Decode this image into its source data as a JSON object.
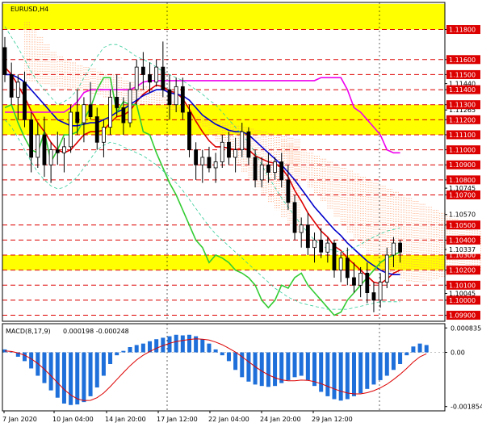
{
  "chart_data": {
    "type": "candlestick",
    "title": "EURUSD,H4",
    "price_scale": {
      "ylim": [
        1.0986,
        1.1198
      ],
      "tick_labels": [
        "1.11800",
        "1.11600",
        "1.11500",
        "1.11440",
        "1.11400",
        "1.11265",
        "1.11300",
        "1.11200",
        "1.11100",
        "1.11000",
        "1.10900",
        "1.10800",
        "1.10745",
        "1.10700",
        "1.10570",
        "1.10500",
        "1.10400",
        "1.10300",
        "1.10337",
        "1.10200",
        "1.10100",
        "1.10045",
        "1.10000",
        "1.09900"
      ],
      "current_price": "1.10337"
    },
    "x_tick_labels": [
      "7 Jan 2020",
      "10 Jan 04:00",
      "14 Jan 20:00",
      "17 Jan 12:00",
      "22 Jan 04:00",
      "24 Jan 20:00",
      "29 Jan 12:00"
    ],
    "levels": [
      1.118,
      1.116,
      1.115,
      1.114,
      1.113,
      1.112,
      1.111,
      1.11,
      1.109,
      1.108,
      1.107,
      1.105,
      1.104,
      1.103,
      1.102,
      1.101,
      1.1,
      1.099
    ],
    "zones": [
      {
        "from": 1.118,
        "to": 1.1197
      },
      {
        "from": 1.111,
        "to": 1.113
      },
      {
        "from": 1.102,
        "to": 1.103
      }
    ],
    "ohlc": [
      [
        1.1168,
        1.1175,
        1.1145,
        1.115
      ],
      [
        1.115,
        1.1158,
        1.113,
        1.1135
      ],
      [
        1.1135,
        1.115,
        1.112,
        1.1145
      ],
      [
        1.1145,
        1.1152,
        1.1115,
        1.112
      ],
      [
        1.112,
        1.1125,
        1.1085,
        1.1095
      ],
      [
        1.1095,
        1.1118,
        1.1088,
        1.111
      ],
      [
        1.111,
        1.1122,
        1.1082,
        1.109
      ],
      [
        1.109,
        1.1105,
        1.1078,
        1.11
      ],
      [
        1.11,
        1.1112,
        1.109,
        1.1098
      ],
      [
        1.1098,
        1.1108,
        1.1085,
        1.1102
      ],
      [
        1.1102,
        1.113,
        1.1098,
        1.1125
      ],
      [
        1.1125,
        1.114,
        1.111,
        1.1118
      ],
      [
        1.1118,
        1.1135,
        1.1105,
        1.113
      ],
      [
        1.113,
        1.1145,
        1.112,
        1.1122
      ],
      [
        1.1122,
        1.1128,
        1.11,
        1.1105
      ],
      [
        1.1105,
        1.112,
        1.1095,
        1.1115
      ],
      [
        1.1115,
        1.114,
        1.111,
        1.1135
      ],
      [
        1.1135,
        1.115,
        1.1122,
        1.1128
      ],
      [
        1.1128,
        1.1135,
        1.111,
        1.1118
      ],
      [
        1.1118,
        1.1145,
        1.1115,
        1.114
      ],
      [
        1.114,
        1.116,
        1.113,
        1.1155
      ],
      [
        1.1155,
        1.1165,
        1.114,
        1.115
      ],
      [
        1.115,
        1.1158,
        1.1138,
        1.1145
      ],
      [
        1.1145,
        1.116,
        1.1142,
        1.1155
      ],
      [
        1.1155,
        1.1172,
        1.1135,
        1.114
      ],
      [
        1.114,
        1.115,
        1.112,
        1.113
      ],
      [
        1.113,
        1.1148,
        1.1125,
        1.1142
      ],
      [
        1.1142,
        1.1148,
        1.112,
        1.1125
      ],
      [
        1.1125,
        1.113,
        1.1095,
        1.11
      ],
      [
        1.11,
        1.1105,
        1.108,
        1.109
      ],
      [
        1.109,
        1.11,
        1.1078,
        1.1095
      ],
      [
        1.1095,
        1.1102,
        1.1085,
        1.1088
      ],
      [
        1.1088,
        1.1098,
        1.1078,
        1.1092
      ],
      [
        1.1092,
        1.111,
        1.1088,
        1.1105
      ],
      [
        1.1105,
        1.1112,
        1.109,
        1.1095
      ],
      [
        1.1095,
        1.1108,
        1.1085,
        1.11
      ],
      [
        1.11,
        1.1118,
        1.1095,
        1.1112
      ],
      [
        1.1112,
        1.1115,
        1.109,
        1.1095
      ],
      [
        1.1095,
        1.11,
        1.1075,
        1.108
      ],
      [
        1.108,
        1.1095,
        1.1075,
        1.109
      ],
      [
        1.109,
        1.1098,
        1.1078,
        1.1085
      ],
      [
        1.1085,
        1.1095,
        1.108,
        1.1092
      ],
      [
        1.1092,
        1.1098,
        1.1075,
        1.108
      ],
      [
        1.108,
        1.109,
        1.106,
        1.1065
      ],
      [
        1.1065,
        1.107,
        1.104,
        1.1045
      ],
      [
        1.1045,
        1.1055,
        1.1035,
        1.105
      ],
      [
        1.105,
        1.1058,
        1.103,
        1.1035
      ],
      [
        1.1035,
        1.1045,
        1.1025,
        1.104
      ],
      [
        1.104,
        1.1048,
        1.1028,
        1.1032
      ],
      [
        1.1032,
        1.1042,
        1.1025,
        1.1038
      ],
      [
        1.1038,
        1.104,
        1.1015,
        1.102
      ],
      [
        1.102,
        1.1032,
        1.1012,
        1.1028
      ],
      [
        1.1028,
        1.1035,
        1.101,
        1.1015
      ],
      [
        1.1015,
        1.1025,
        1.1005,
        1.101
      ],
      [
        1.101,
        1.1022,
        1.1002,
        1.1018
      ],
      [
        1.1018,
        1.1025,
        1.0998,
        1.1005
      ],
      [
        1.1005,
        1.1012,
        1.0992,
        1.1
      ],
      [
        1.1,
        1.1018,
        1.0995,
        1.1012
      ],
      [
        1.1012,
        1.1035,
        1.1008,
        1.103
      ],
      [
        1.103,
        1.1042,
        1.1022,
        1.1038
      ],
      [
        1.1038,
        1.104,
        1.1025,
        1.1032
      ]
    ],
    "indicator": {
      "name": "MACD(8,17,9)",
      "values_label": "0.000198 -0.000248",
      "ylim": [
        -0.002,
        0.00098
      ],
      "tick_labels": [
        "0.000835",
        "0.00",
        "-0.001854"
      ],
      "histogram": [
        0.0001,
        2e-05,
        -0.00015,
        -0.0003,
        -0.00055,
        -0.0008,
        -0.00105,
        -0.0013,
        -0.00155,
        -0.00175,
        -0.0018,
        -0.00178,
        -0.0017,
        -0.0015,
        -0.0012,
        -0.0008,
        -0.0004,
        -0.0001,
        5e-05,
        0.00018,
        0.00025,
        0.0003,
        0.00038,
        0.00045,
        0.0005,
        0.00055,
        0.0006,
        0.00058,
        0.0006,
        0.00055,
        0.00045,
        0.0003,
        0.0001,
        -0.0001,
        -0.0003,
        -0.0006,
        -0.00085,
        -0.001,
        -0.0011,
        -0.00115,
        -0.00118,
        -0.00115,
        -0.00105,
        -0.00095,
        -0.00085,
        -0.0008,
        -0.00095,
        -0.00115,
        -0.00135,
        -0.0015,
        -0.0016,
        -0.00165,
        -0.0016,
        -0.0015,
        -0.0014,
        -0.00125,
        -0.0011,
        -0.00095,
        -0.0008,
        -0.0006,
        -0.0004,
        -0.0001,
        0.0002,
        0.0003,
        0.00025
      ],
      "signal": [
        5e-05,
        3e-05,
        -2e-05,
        -0.0001,
        -0.00022,
        -0.00038,
        -0.00058,
        -0.0008,
        -0.00104,
        -0.00127,
        -0.00146,
        -0.00159,
        -0.00165,
        -0.00164,
        -0.00155,
        -0.00139,
        -0.00117,
        -0.00093,
        -0.00069,
        -0.00046,
        -0.00026,
        -0.0001,
        3e-05,
        0.00014,
        0.00023,
        0.00031,
        0.00037,
        0.00041,
        0.00044,
        0.00046,
        0.00045,
        0.00042,
        0.00035,
        0.00026,
        0.00014,
        1e-05,
        -0.00015,
        -0.00032,
        -0.00049,
        -0.00064,
        -0.00077,
        -0.00087,
        -0.00094,
        -0.00097,
        -0.00097,
        -0.00095,
        -0.00096,
        -0.001,
        -0.00107,
        -0.00116,
        -0.00125,
        -0.00133,
        -0.00139,
        -0.00142,
        -0.00142,
        -0.00138,
        -0.00131,
        -0.00121,
        -0.00109,
        -0.00093,
        -0.00075,
        -0.00055,
        -0.00033,
        -0.00015,
        -5e-05
      ]
    },
    "series": [
      {
        "color": "#dd0000",
        "values": [
          1.1155,
          1.115,
          1.1143,
          1.1135,
          1.1126,
          1.1118,
          1.1112,
          1.1105,
          1.11,
          1.1098,
          1.11,
          1.1105,
          1.111,
          1.1112,
          1.1112,
          1.1113,
          1.1118,
          1.1122,
          1.1123,
          1.1126,
          1.1132,
          1.1137,
          1.114,
          1.1143,
          1.1142,
          1.1139,
          1.1138,
          1.1134,
          1.1127,
          1.1119,
          1.1112,
          1.1106,
          1.1102,
          1.1102,
          1.1101,
          1.11,
          1.1101,
          1.11,
          1.1096,
          1.1094,
          1.1092,
          1.1091,
          1.1088,
          1.1082,
          1.1073,
          1.1066,
          1.1058,
          1.1052,
          1.1046,
          1.1042,
          1.1036,
          1.1033,
          1.1028,
          1.1024,
          1.102,
          1.1016,
          1.1012,
          1.1011,
          1.1014,
          1.1018,
          1.102
        ]
      },
      {
        "color": "#0000cc",
        "values": [
          1.115,
          1.115,
          1.1148,
          1.1145,
          1.114,
          1.1135,
          1.113,
          1.1125,
          1.112,
          1.1118,
          1.1116,
          1.1116,
          1.1117,
          1.1118,
          1.1118,
          1.112,
          1.1122,
          1.1125,
          1.1127,
          1.113,
          1.1133,
          1.1136,
          1.1138,
          1.114,
          1.114,
          1.1138,
          1.1137,
          1.1136,
          1.1133,
          1.1128,
          1.1123,
          1.112,
          1.1117,
          1.1115,
          1.1113,
          1.1112,
          1.1112,
          1.111,
          1.1106,
          1.1102,
          1.1098,
          1.1094,
          1.109,
          1.1085,
          1.108,
          1.1074,
          1.1068,
          1.1062,
          1.1057,
          1.1052,
          1.1047,
          1.1043,
          1.1038,
          1.1034,
          1.103,
          1.1026,
          1.1023,
          1.102,
          1.1018,
          1.1017,
          1.1017
        ]
      },
      {
        "color": "#ee00ee",
        "values": [
          1.1125,
          1.1125,
          1.1125,
          1.1125,
          1.1125,
          1.1125,
          1.1125,
          1.1125,
          1.1125,
          1.1125,
          1.1128,
          1.1132,
          1.1138,
          1.114,
          1.114,
          1.114,
          1.114,
          1.114,
          1.114,
          1.114,
          1.1142,
          1.1145,
          1.1146,
          1.1146,
          1.1146,
          1.1146,
          1.1146,
          1.1146,
          1.1146,
          1.1146,
          1.1146,
          1.1146,
          1.1146,
          1.1146,
          1.1146,
          1.1146,
          1.1146,
          1.1146,
          1.1146,
          1.1146,
          1.1146,
          1.1146,
          1.1146,
          1.1146,
          1.1146,
          1.1146,
          1.1146,
          1.1146,
          1.1148,
          1.1148,
          1.1148,
          1.1148,
          1.114,
          1.1128,
          1.1125,
          1.112,
          1.1115,
          1.111,
          1.11,
          1.1098,
          1.1098
        ]
      },
      {
        "color": "#33cc33",
        "values": [
          1.1128,
          1.113,
          1.1118,
          1.1108,
          1.11,
          1.1098,
          1.1112,
          1.1092,
          1.11,
          1.111,
          1.111,
          1.1112,
          1.112,
          1.1128,
          1.114,
          1.1148,
          1.1148,
          1.1125,
          1.1132,
          1.113,
          1.113,
          1.1112,
          1.111,
          1.1098,
          1.1088,
          1.1078,
          1.107,
          1.106,
          1.105,
          1.104,
          1.1035,
          1.1025,
          1.103,
          1.1028,
          1.1025,
          1.102,
          1.1018,
          1.1015,
          1.101,
          1.1,
          1.0995,
          1.1,
          1.101,
          1.1008,
          1.1015,
          1.1018,
          1.101,
          1.1005,
          1.1,
          1.0995,
          1.099,
          1.0992,
          1.1,
          1.1005,
          1.101,
          1.1015,
          1.102,
          1.1025,
          1.1028,
          1.103,
          1.1032
        ]
      },
      {
        "color": "#33cc99",
        "values": [
          1.1182,
          1.1175,
          1.1168,
          1.116,
          1.1152,
          1.1145,
          1.114,
          1.1135,
          1.113,
          1.1132,
          1.1135,
          1.114,
          1.1148,
          1.1155,
          1.1162,
          1.1168,
          1.117,
          1.117,
          1.1168,
          1.1165,
          1.1162,
          1.116,
          1.1158,
          1.1155,
          1.1152,
          1.115,
          1.1148,
          1.1146,
          1.1143,
          1.114,
          1.1137,
          1.1133,
          1.113,
          1.1125,
          1.112,
          1.1115,
          1.111,
          1.1105,
          1.1098,
          1.109,
          1.1082,
          1.1075,
          1.1068,
          1.1062,
          1.1056,
          1.105,
          1.1045,
          1.104,
          1.1037,
          1.1034,
          1.1033,
          1.1032,
          1.1033,
          1.1035,
          1.1037,
          1.104,
          1.1042,
          1.1044,
          1.1046,
          1.1047,
          1.1048
        ]
      },
      {
        "color": "#33cc99",
        "values": [
          1.112,
          1.1115,
          1.1108,
          1.11,
          1.1092,
          1.1085,
          1.108,
          1.1076,
          1.1074,
          1.1075,
          1.1078,
          1.1082,
          1.1088,
          1.1094,
          1.11,
          1.1103,
          1.1105,
          1.1104,
          1.1102,
          1.11,
          1.1098,
          1.1096,
          1.1093,
          1.109,
          1.1086,
          1.1082,
          1.1078,
          1.1073,
          1.1067,
          1.1061,
          1.1055,
          1.1049,
          1.1044,
          1.104,
          1.1036,
          1.1032,
          1.1028,
          1.1024,
          1.102,
          1.1016,
          1.1012,
          1.1008,
          1.1005,
          1.1002,
          1.1,
          1.0998,
          1.0997,
          1.0996,
          1.0995,
          1.0994,
          1.0994,
          1.0994,
          1.0994,
          1.0995,
          1.0996,
          1.0997,
          1.0998,
          1.0999,
          1.0999,
          1.0999,
          1.0999
        ]
      }
    ],
    "cloud_bands": [
      {
        "color": "#ff9966",
        "from": [
          1.1185,
          1.118,
          1.1175,
          1.117,
          1.1165,
          1.1162,
          1.116,
          1.1158,
          1.1156,
          1.1155,
          1.1154,
          1.1152,
          1.115,
          1.115,
          1.1148,
          1.1146,
          1.1145,
          1.1144,
          1.1142,
          1.114,
          1.1138,
          1.1135,
          1.1132,
          1.1128,
          1.1125,
          1.112,
          1.1118,
          1.1115,
          1.111,
          1.1105,
          1.11,
          1.1095,
          1.109,
          1.1085,
          1.108,
          1.1075,
          1.107,
          1.1065,
          1.106,
          1.1055,
          1.105,
          1.1045
        ],
        "to": [
          1.1145,
          1.1145,
          1.1144,
          1.1143,
          1.1142,
          1.1141,
          1.114,
          1.114,
          1.1139,
          1.1138,
          1.1137,
          1.1136,
          1.1135,
          1.1134,
          1.1133,
          1.1132,
          1.1131,
          1.113,
          1.113,
          1.1129,
          1.1128,
          1.1127,
          1.1126,
          1.1125,
          1.1124,
          1.1123,
          1.1122,
          1.1121,
          1.112,
          1.1119,
          1.1118,
          1.1117,
          1.1116,
          1.1115,
          1.1114,
          1.1113,
          1.1112,
          1.1111,
          1.111,
          1.1109,
          1.1108,
          1.1107
        ]
      },
      {
        "color": "#ff9966",
        "from": [
          1.1106,
          1.1104,
          1.1102,
          1.11,
          1.1098,
          1.1096,
          1.1094,
          1.1092,
          1.109,
          1.1088,
          1.1086,
          1.1084,
          1.1082,
          1.108,
          1.1078,
          1.1076,
          1.1074,
          1.1072,
          1.107,
          1.1068,
          1.1066,
          1.1064,
          1.1062,
          1.106,
          1.1058,
          1.1056,
          1.1054,
          1.1052,
          1.105,
          1.1048,
          1.1046,
          1.1044,
          1.1042,
          1.104,
          1.1038,
          1.1036,
          1.1034,
          1.1032,
          1.103,
          1.1028,
          1.1026,
          1.1024,
          1.1022,
          1.102,
          1.1019,
          1.1018,
          1.1017,
          1.1016
        ],
        "to": [
          1.1095,
          1.109,
          1.1085,
          1.108,
          1.1075,
          1.107,
          1.1065,
          1.106,
          1.1055,
          1.105,
          1.1045,
          1.104,
          1.1035,
          1.103,
          1.1025,
          1.102,
          1.1018,
          1.1016,
          1.1014,
          1.1012,
          1.1012,
          1.1012,
          1.1013,
          1.1014,
          1.1015,
          1.1016,
          1.1017,
          1.1018,
          1.1018,
          1.1018,
          1.1019,
          1.1019,
          1.102,
          1.102,
          1.1021,
          1.1021,
          1.1022,
          1.1022,
          1.1023,
          1.1023,
          1.1024,
          1.1024,
          1.1025,
          1.1025,
          1.1025,
          1.1025,
          1.1025,
          1.1025
        ]
      }
    ]
  }
}
